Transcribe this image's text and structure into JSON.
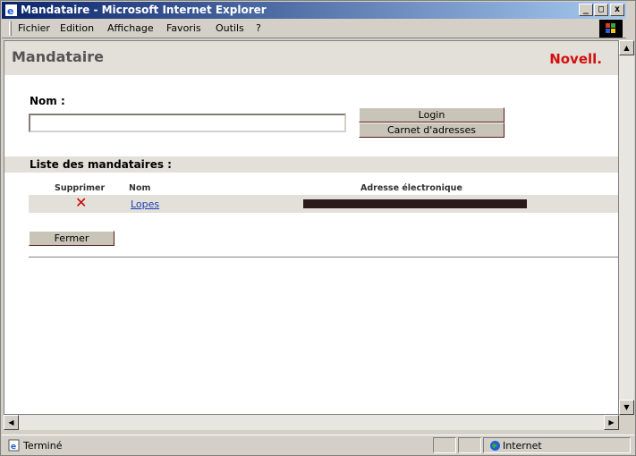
{
  "window": {
    "title": "Mandataire - Microsoft Internet Explorer",
    "minimize": "_",
    "maximize": "□",
    "close": "x"
  },
  "menu": {
    "items": [
      "Fichier",
      "Edition",
      "Affichage",
      "Favoris",
      "Outils",
      "?"
    ]
  },
  "page": {
    "title": "Mandataire",
    "logo": "Novell.",
    "nom_label": "Nom :",
    "nom_value": "",
    "login_button": "Login",
    "carnet_button": "Carnet d'adresses",
    "list_title": "Liste des mandataires :",
    "columns": {
      "delete": "Supprimer",
      "name": "Nom",
      "email": "Adresse électronique"
    },
    "rows": [
      {
        "delete_icon": "✕",
        "name": "Lopes",
        "email": ""
      }
    ],
    "close_button": "Fermer"
  },
  "status": {
    "text": "Terminé",
    "zone": "Internet"
  },
  "colors": {
    "accent": "#d31010",
    "header_bg": "#e3e0d9",
    "titlebar": "#0a246a"
  },
  "icons": {
    "window": "ie-icon",
    "status": "page-icon",
    "zone": "globe-icon",
    "delete": "red-x-icon"
  }
}
